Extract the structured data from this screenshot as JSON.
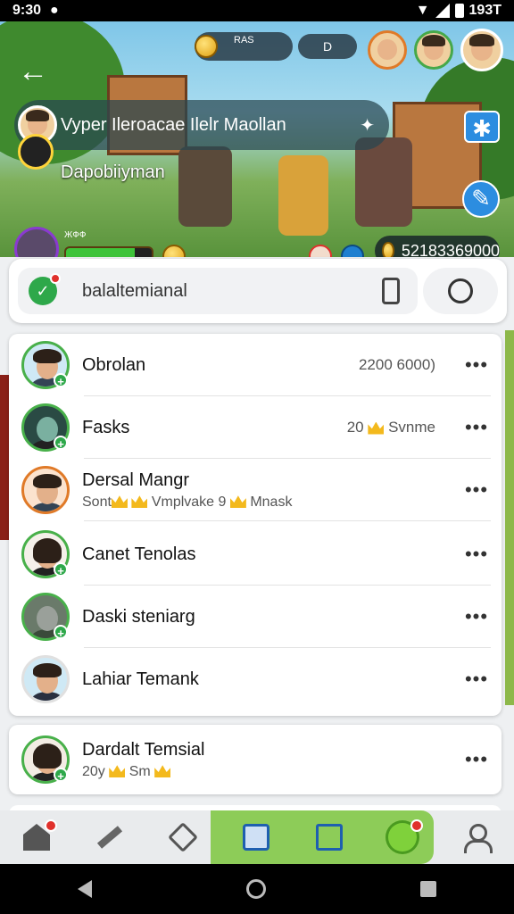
{
  "status_bar": {
    "time": "9:30",
    "battery_text": "193T"
  },
  "header": {
    "hud_top_label": "RAS",
    "hud_top_value": "D",
    "player_banner": "Vyper Ileroacae Ilelr Maollan",
    "player_sub": "Dapobiiyman",
    "small_label": "ЖФФ",
    "score": "52183369000"
  },
  "search": {
    "placeholder": "balaltemianal",
    "value": "balaltemianal"
  },
  "contacts": [
    {
      "title": "Obrolan",
      "subtitle": "",
      "meta": "2200 6000)",
      "avatar_ring": "green"
    },
    {
      "title": "Fasks",
      "subtitle": "",
      "meta": "20",
      "meta2": "Svnme",
      "avatar_ring": "green"
    },
    {
      "title": "Dersal Mangr",
      "subtitle": "Sont",
      "subtitle2": "Vmplvake 9",
      "subtitle3": "Mnask",
      "meta": "",
      "avatar_ring": "orange"
    },
    {
      "title": "Canet Tenolas",
      "subtitle": "",
      "meta": "",
      "avatar_ring": "green"
    },
    {
      "title": "Daski steniarg",
      "subtitle": "",
      "meta": "",
      "avatar_ring": "green"
    },
    {
      "title": "Lahiar Temank",
      "subtitle": "",
      "meta": "",
      "avatar_ring": "green"
    }
  ],
  "featured": {
    "title": "Dardalt Temsial",
    "subtitle": "20y",
    "subtitle2": "Sm"
  },
  "more_label": "•••",
  "tabbar": {
    "items": [
      "home",
      "craft",
      "inventory",
      "tasks",
      "edit",
      "pet",
      "profile"
    ]
  },
  "icons": {
    "back": "back-arrow-icon",
    "search_badge": "check-badge-icon",
    "chat": "chat-bubble-icon"
  },
  "colors": {
    "accent_green": "#2ea84a",
    "tab_highlight": "#8dcc58",
    "alert_red": "#e0312c"
  }
}
